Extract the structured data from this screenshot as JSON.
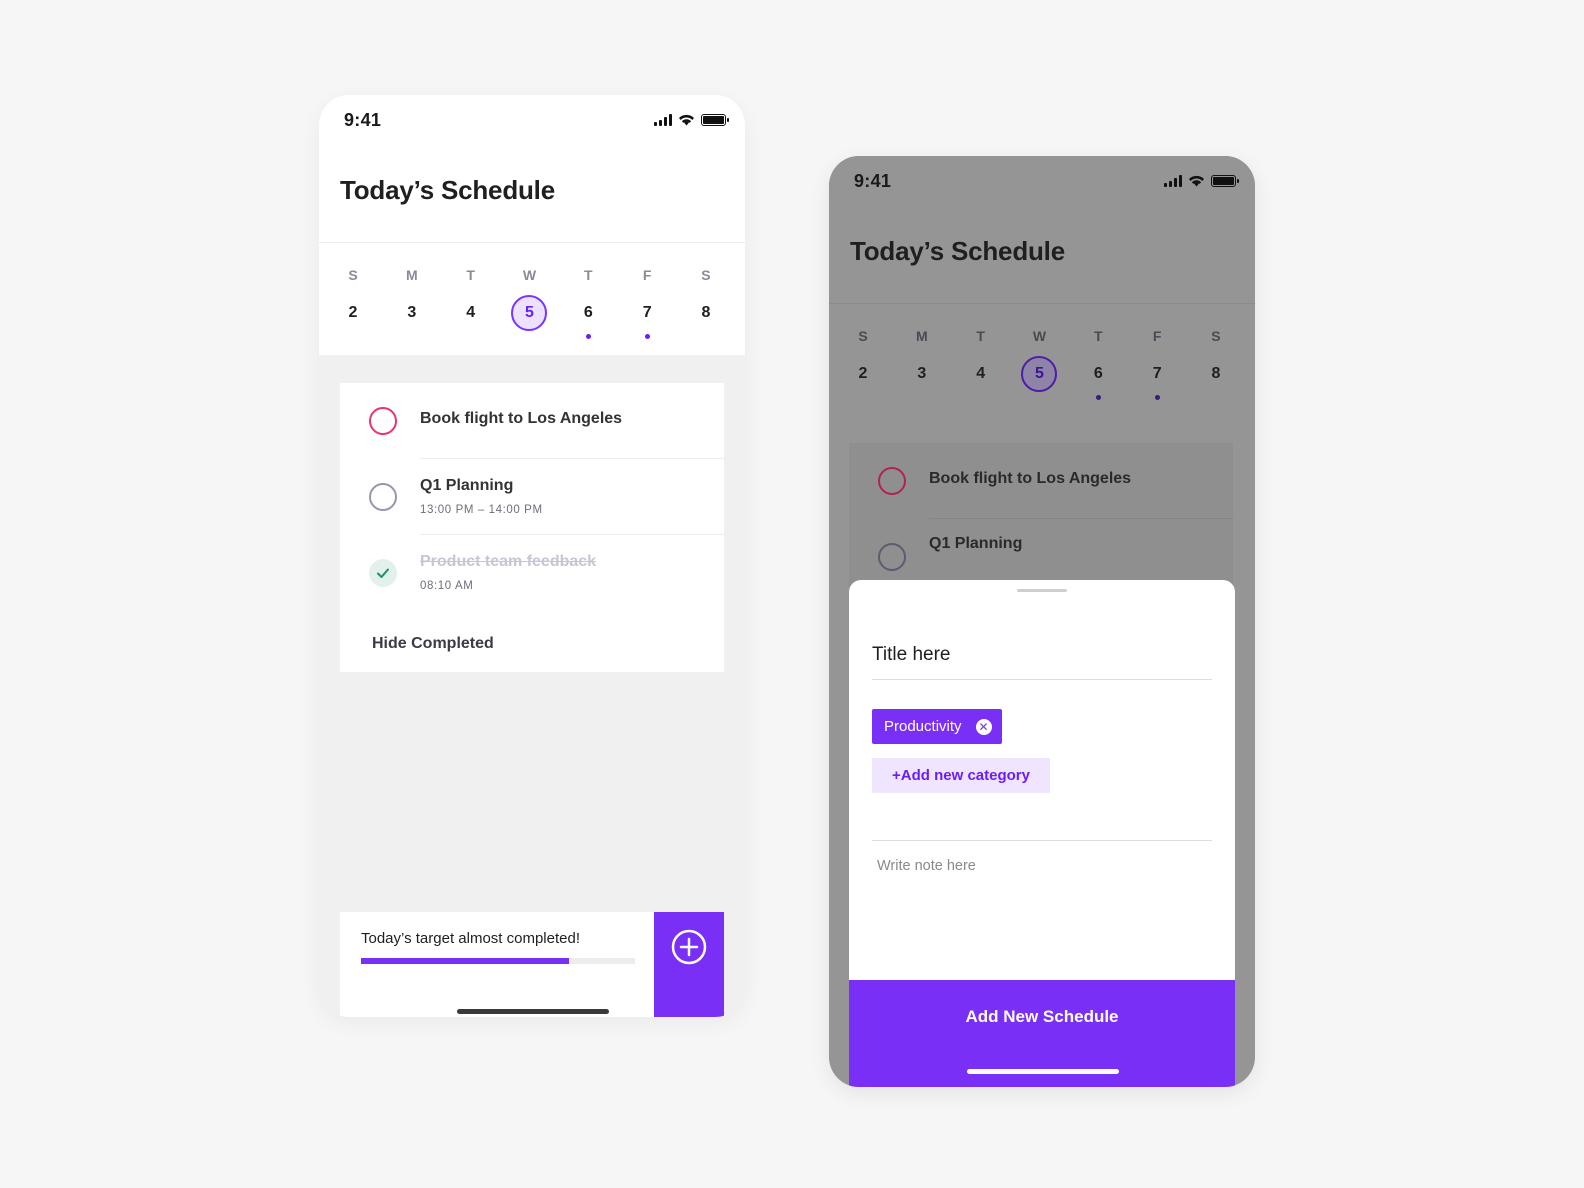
{
  "status_bar": {
    "time": "9:41"
  },
  "screen_title": "Today’s Schedule",
  "week": [
    {
      "letter": "S",
      "num": "2",
      "selected": false,
      "dot": false
    },
    {
      "letter": "M",
      "num": "3",
      "selected": false,
      "dot": false
    },
    {
      "letter": "T",
      "num": "4",
      "selected": false,
      "dot": false
    },
    {
      "letter": "W",
      "num": "5",
      "selected": true,
      "dot": false
    },
    {
      "letter": "T",
      "num": "6",
      "selected": false,
      "dot": true
    },
    {
      "letter": "F",
      "num": "7",
      "selected": false,
      "dot": true
    },
    {
      "letter": "S",
      "num": "8",
      "selected": false,
      "dot": false
    }
  ],
  "tasks": [
    {
      "title": "Book flight to Los Angeles",
      "time": "",
      "completed": false,
      "color": "#e8336d"
    },
    {
      "title": "Q1 Planning",
      "time": "13:00 PM – 14:00 PM",
      "completed": false,
      "color": "#9a94b0"
    },
    {
      "title": "Product team feedback",
      "time": "08:10 AM",
      "completed": true,
      "color": "#1f8f6e"
    }
  ],
  "hide_completed_label": "Hide Completed",
  "target": {
    "text": "Today’s target almost completed!",
    "progress": 0.76
  },
  "sheet": {
    "title_placeholder": "Title here",
    "category_chip": "Productivity",
    "add_category_label": "+Add new category",
    "note_placeholder": "Write note here",
    "submit_label": "Add New Schedule"
  },
  "colors": {
    "accent": "#7a2ff7",
    "accent_light": "#efe5ff",
    "pink": "#e8336d"
  }
}
